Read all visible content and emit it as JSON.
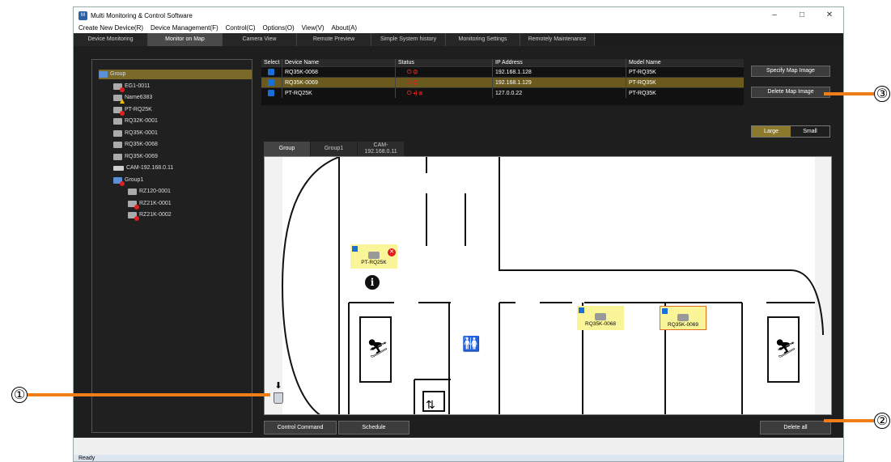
{
  "window": {
    "title": "Multi Monitoring & Control Software",
    "minimize": "–",
    "maximize": "□",
    "close": "✕"
  },
  "menu": [
    "Create New Device(R)",
    "Device Management(F)",
    "Control(C)",
    "Options(O)",
    "View(V)",
    "About(A)"
  ],
  "tabs": [
    "Device Monitoring",
    "Monitor on Map",
    "Camera View",
    "Remote Preview",
    "Simple System history",
    "Monitoring Settings",
    "Remotely Maintenance"
  ],
  "active_tab": "Monitor on Map",
  "tree": [
    {
      "label": "Group",
      "level": 0,
      "kind": "group",
      "selected": true
    },
    {
      "label": "EG1-0011",
      "level": 1,
      "kind": "dev-err"
    },
    {
      "label": "Name6383",
      "level": 1,
      "kind": "dev-warn"
    },
    {
      "label": "PT-RQ25K",
      "level": 1,
      "kind": "dev-err"
    },
    {
      "label": "RQ32K-0001",
      "level": 1,
      "kind": "dev"
    },
    {
      "label": "RQ35K-0001",
      "level": 1,
      "kind": "dev"
    },
    {
      "label": "RQ35K-0068",
      "level": 1,
      "kind": "dev"
    },
    {
      "label": "RQ35K-0069",
      "level": 1,
      "kind": "dev"
    },
    {
      "label": "CAM-192.168.0.11",
      "level": 1,
      "kind": "cam"
    },
    {
      "label": "Group1",
      "level": 1,
      "kind": "group-err"
    },
    {
      "label": "RZ120-0001",
      "level": 2,
      "kind": "dev"
    },
    {
      "label": "RZ21K-0001",
      "level": 2,
      "kind": "dev-err"
    },
    {
      "label": "RZ21K-0002",
      "level": 2,
      "kind": "dev-err"
    }
  ],
  "grid": {
    "headers": [
      "Select",
      "Device Name",
      "Status",
      "IP Address",
      "Model Name"
    ],
    "rows": [
      {
        "name": "RQ35K-0068",
        "status": "⏻ ⚙",
        "ip": "192.168.1.128",
        "model": "PT-RQ35K",
        "selected": false
      },
      {
        "name": "RQ35K-0069",
        "status": "⏻ ⚙",
        "ip": "192.168.1.129",
        "model": "PT-RQ35K",
        "selected": true
      },
      {
        "name": "PT-RQ25K",
        "status": "⏻ ◂) ⊗",
        "ip": "127.0.0.22",
        "model": "PT-RQ35K",
        "selected": false
      }
    ]
  },
  "buttons": {
    "specify_map": "Specify Map Image",
    "delete_map": "Delete Map Image",
    "large": "Large",
    "small": "Small",
    "control_command": "Control Command",
    "schedule": "Schedule",
    "delete_all": "Delete all"
  },
  "map_tabs": [
    "Group",
    "Group1",
    "CAM-\n192.168.0.11"
  ],
  "map_devices": [
    {
      "label": "PT-RQ25K",
      "error": true
    },
    {
      "label": "RQ35K-0068",
      "error": false
    },
    {
      "label": "RQ35K-0069",
      "error": false
    }
  ],
  "status_text": "Ready",
  "callouts": [
    "①",
    "②",
    "③"
  ],
  "colors": {
    "callout": "#ef7d1a",
    "selected_row": "#6b5a1d",
    "checkbox": "#1a6fd6",
    "device_box": "#fbf59a"
  }
}
